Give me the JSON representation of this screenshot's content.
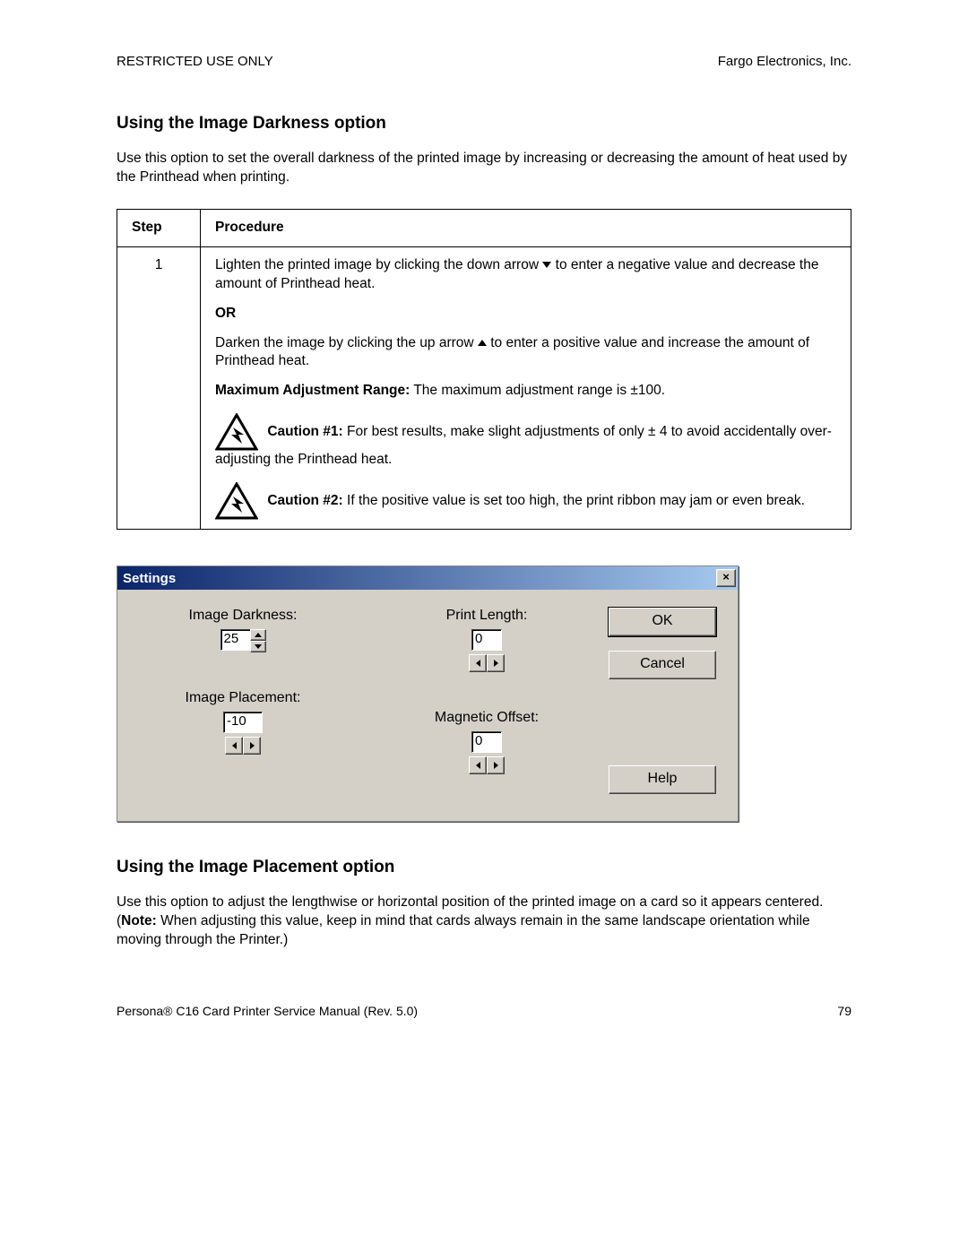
{
  "header": {
    "left": "RESTRICTED USE ONLY",
    "right": "Fargo Electronics, Inc."
  },
  "section1": {
    "heading": "Using the Image Darkness option",
    "intro": "Use this option to set the overall darkness of the printed image by increasing or decreasing the amount of heat used by the Printhead when printing."
  },
  "table": {
    "col_step": "Step",
    "col_proc": "Procedure",
    "step_num": "1",
    "lighten_a": "Lighten the printed image by clicking the down arrow ",
    "lighten_b": " to enter a negative value and decrease the amount of Printhead heat.",
    "or": "OR",
    "darken_a": "Darken the image by clicking the up arrow ",
    "darken_b": " to enter a positive value and increase the amount of Printhead heat.",
    "max_label": "Maximum Adjustment Range:",
    "max_text": "  The maximum adjustment range is ±100.",
    "c1_label": "Caution #1:",
    "c1_text": "  For best results, make slight adjustments of only ± 4 to avoid accidentally over-adjusting the Printhead heat.",
    "c2_label": "Caution #2:",
    "c2_text": "  If the positive value is set too high, the print ribbon may jam or even break."
  },
  "dialog": {
    "title": "Settings",
    "close": "×",
    "image_darkness_label": "Image Darkness:",
    "image_darkness_value": "25",
    "print_length_label": "Print Length:",
    "print_length_value": "0",
    "image_placement_label": "Image Placement:",
    "image_placement_value": "-10",
    "magnetic_offset_label": "Magnetic Offset:",
    "magnetic_offset_value": "0",
    "ok": "OK",
    "cancel": "Cancel",
    "help": "Help"
  },
  "section2": {
    "heading": "Using the Image Placement option",
    "intro_a": "Use this option to adjust the lengthwise or horizontal position of the printed image on a card so it appears centered. (",
    "note_label": "Note:",
    "intro_b": "  When adjusting this value, keep in mind that cards always remain in the same landscape orientation while moving through the Printer.)"
  },
  "footer": {
    "left": "Persona® C16 Card Printer Service Manual (Rev. 5.0)",
    "right": "79"
  }
}
